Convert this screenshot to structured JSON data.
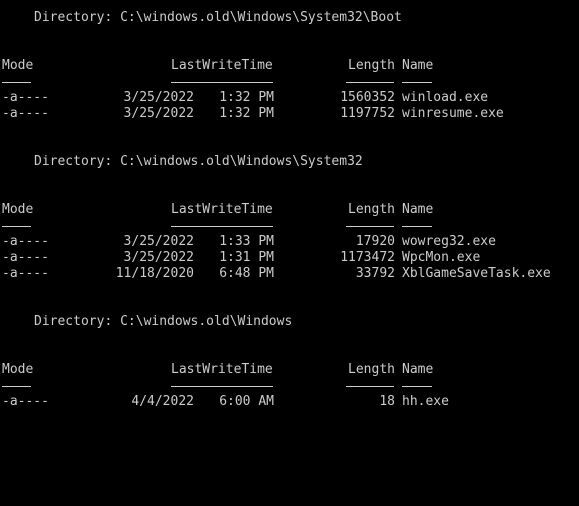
{
  "colors": {
    "background": "#000000",
    "foreground": "#cccccc"
  },
  "headers": {
    "mode": "Mode",
    "last_write_time": "LastWriteTime",
    "length": "Length",
    "name": "Name"
  },
  "sections": [
    {
      "directory_label": "Directory: C:\\windows.old\\Windows\\System32\\Boot",
      "rows": [
        {
          "mode": "-a----",
          "date": "3/25/2022",
          "time": "1:32 PM",
          "length": "1560352",
          "name": "winload.exe"
        },
        {
          "mode": "-a----",
          "date": "3/25/2022",
          "time": "1:32 PM",
          "length": "1197752",
          "name": "winresume.exe"
        }
      ]
    },
    {
      "directory_label": "Directory: C:\\windows.old\\Windows\\System32",
      "rows": [
        {
          "mode": "-a----",
          "date": "3/25/2022",
          "time": "1:33 PM",
          "length": "17920",
          "name": "wowreg32.exe"
        },
        {
          "mode": "-a----",
          "date": "3/25/2022",
          "time": "1:31 PM",
          "length": "1173472",
          "name": "WpcMon.exe"
        },
        {
          "mode": "-a----",
          "date": "11/18/2020",
          "time": "6:48 PM",
          "length": "33792",
          "name": "XblGameSaveTask.exe"
        }
      ]
    },
    {
      "directory_label": "Directory: C:\\windows.old\\Windows",
      "rows": [
        {
          "mode": "-a----",
          "date": "4/4/2022",
          "time": "6:00 AM",
          "length": "18",
          "name": "hh.exe"
        }
      ]
    }
  ]
}
